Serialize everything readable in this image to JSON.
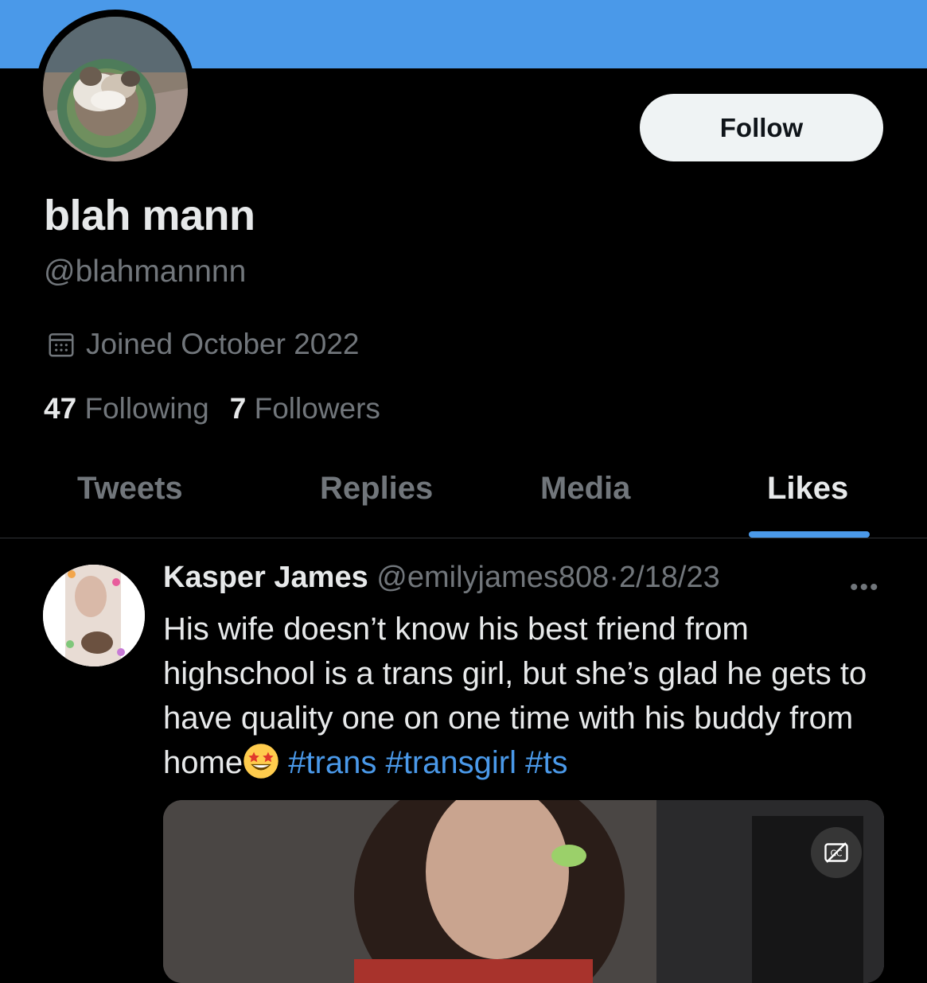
{
  "profile": {
    "display_name": "blah mann",
    "handle": "@blahmannnn",
    "joined": "Joined October 2022",
    "following_count": "47",
    "following_label": "Following",
    "followers_count": "7",
    "followers_label": "Followers",
    "follow_button": "Follow"
  },
  "tabs": [
    {
      "label": "Tweets",
      "active": false
    },
    {
      "label": "Replies",
      "active": false
    },
    {
      "label": "Media",
      "active": false
    },
    {
      "label": "Likes",
      "active": true
    }
  ],
  "tweet": {
    "author_name": "Kasper James",
    "author_handle": "@emilyjames808",
    "separator": "·",
    "date": "2/18/23",
    "text_part1": "His wife doesn’t know his best friend from highschool is a trans girl, but she’s glad he gets to have quality one on one time with his buddy from home",
    "emoji": "star-struck-emoji",
    "hashtags": [
      "#trans",
      "#transgirl",
      "#ts"
    ]
  },
  "icons": {
    "calendar": "calendar-icon",
    "more": "more-icon",
    "captions": "captions-off-icon"
  },
  "colors": {
    "banner": "#4a99e9",
    "accent": "#4a99e9",
    "background": "#000000",
    "muted_text": "#71767b",
    "primary_text": "#e7e9ea",
    "follow_button_bg": "#eff3f4"
  }
}
